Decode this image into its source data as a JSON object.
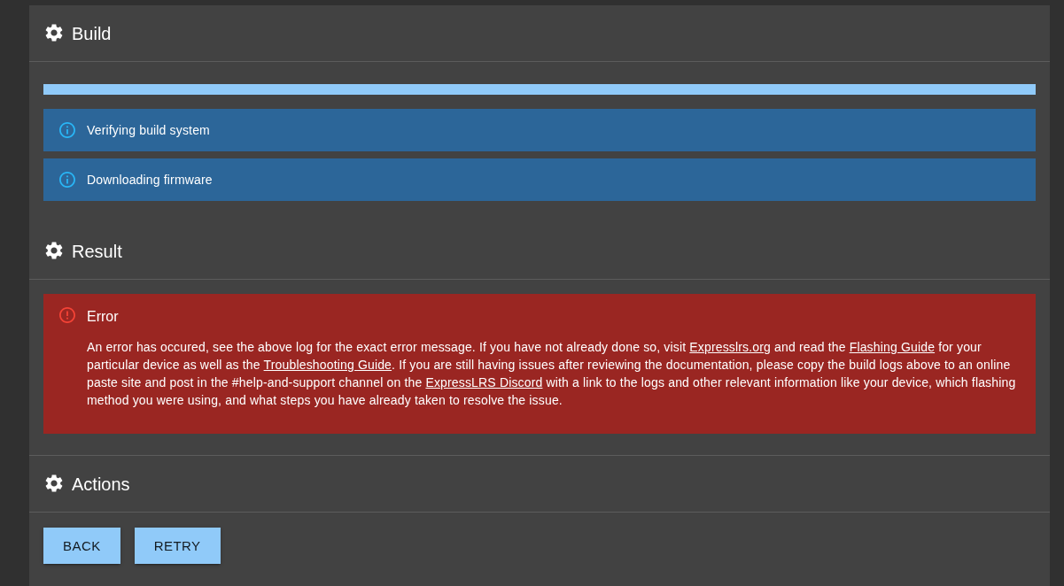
{
  "build": {
    "title": "Build",
    "progress": {
      "level": 1
    },
    "logs": [
      {
        "kind": "info",
        "text": "Verifying build system"
      },
      {
        "kind": "info",
        "text": "Downloading firmware"
      }
    ]
  },
  "result": {
    "title": "Result",
    "alert": {
      "kind": "error",
      "title": "Error",
      "message": [
        {
          "kind": "text",
          "text": "An error has occured, see the above log for the exact error message. If you have not already done so, visit "
        },
        {
          "kind": "link",
          "text": "Expresslrs.org"
        },
        {
          "kind": "text",
          "text": " and read the "
        },
        {
          "kind": "link",
          "text": "Flashing Guide"
        },
        {
          "kind": "text",
          "text": " for your particular device as well as the "
        },
        {
          "kind": "link",
          "text": "Troubleshooting Guide"
        },
        {
          "kind": "text",
          "text": ". If you are still having issues after reviewing the documentation, please copy the build logs above to an online paste site and post in the #help-and-support channel on the "
        },
        {
          "kind": "link",
          "text": "ExpressLRS Discord"
        },
        {
          "kind": "text",
          "text": " with a link to the logs and other relevant information like your device, which flashing method you were using, and what steps you have already taken to resolve the issue."
        }
      ]
    }
  },
  "actions": {
    "title": "Actions",
    "buttons": [
      {
        "label": "BACK"
      },
      {
        "label": "RETRY"
      }
    ]
  }
}
